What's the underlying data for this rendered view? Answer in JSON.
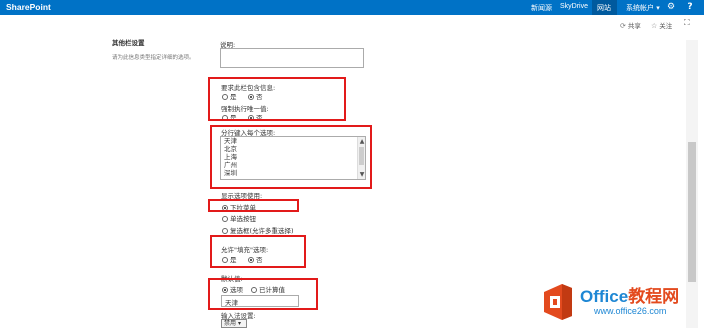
{
  "suitebar": {
    "brand": "SharePoint",
    "links": [
      "新闻源",
      "SkyDrive",
      "网站"
    ],
    "user": "系统帐户",
    "gear_icon": "gear-icon",
    "help_icon": "help-icon"
  },
  "actionbar": {
    "share": "共享",
    "follow": "关注"
  },
  "section": {
    "title": "其他栏设置",
    "description": "请为此信息类型指定详细的选项。"
  },
  "form": {
    "description_label": "说明:",
    "require_label": "要求此栏包含信息:",
    "unique_label": "强制执行唯一值:",
    "yes": "是",
    "no": "否",
    "options_label": "分行键入每个选项:",
    "options": [
      "天津",
      "北京",
      "上海",
      "广州",
      "深圳"
    ],
    "display_label": "显示选项使用:",
    "display_dropdown": "下拉菜单",
    "display_radio": "单选按钮",
    "display_checkbox": "复选框(允许多重选择)",
    "fillin_label": "允许\"填充\"选项:",
    "default_label": "默认值:",
    "default_choice": "选项",
    "default_calc": "已计算值",
    "default_value": "天津",
    "ime_label": "输入法设置:",
    "ime_value": "禁用"
  },
  "watermark": {
    "title_en": "Office",
    "title_cn": "教程网",
    "url": "www.office26.com"
  }
}
